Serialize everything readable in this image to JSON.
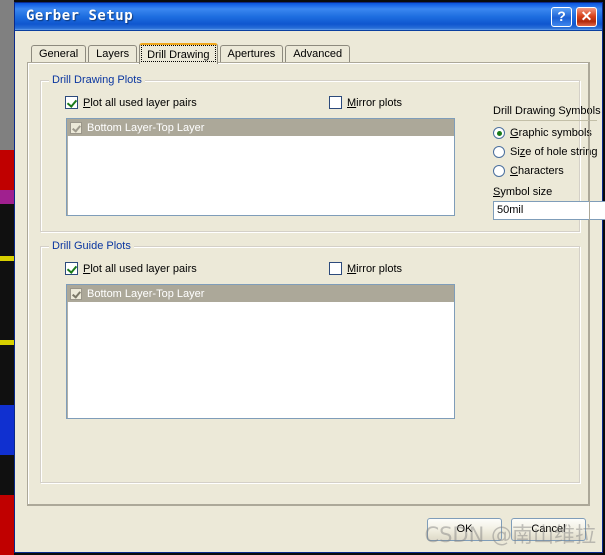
{
  "window": {
    "title": "Gerber Setup",
    "help_button": "?",
    "close_button": "✕"
  },
  "tabs": [
    {
      "label": "General",
      "active": false
    },
    {
      "label": "Layers",
      "active": false
    },
    {
      "label": "Drill Drawing",
      "active": true
    },
    {
      "label": "Apertures",
      "active": false
    },
    {
      "label": "Advanced",
      "active": false
    }
  ],
  "drill_drawing_plots": {
    "group_title": "Drill Drawing Plots",
    "plot_all_label_prefix": "P",
    "plot_all_label_rest": "lot all used layer pairs",
    "plot_all_checked": true,
    "mirror_label_prefix": "M",
    "mirror_label_rest": "irror plots",
    "mirror_checked": false,
    "list_items": [
      {
        "label": "Bottom Layer-Top Layer",
        "checked": true,
        "selected": true
      }
    ]
  },
  "drill_guide_plots": {
    "group_title": "Drill Guide Plots",
    "plot_all_label_prefix": "P",
    "plot_all_label_rest": "lot all used layer pairs",
    "plot_all_checked": true,
    "mirror_label_prefix": "M",
    "mirror_label_rest": "irror plots",
    "mirror_checked": false,
    "list_items": [
      {
        "label": "Bottom Layer-Top Layer",
        "checked": true,
        "selected": true
      }
    ]
  },
  "drill_drawing_symbols": {
    "title": "Drill Drawing Symbols",
    "options": [
      {
        "prefix": "G",
        "rest": "raphic symbols",
        "selected": true
      },
      {
        "prefix_a": "Si",
        "prefix": "z",
        "rest": "e of hole string",
        "selected": false
      },
      {
        "prefix": "C",
        "rest": "haracters",
        "selected": false
      }
    ],
    "symbol_size_label_prefix": "S",
    "symbol_size_label_rest": "ymbol size",
    "symbol_size_value": "50mil"
  },
  "buttons": {
    "ok": "OK",
    "cancel": "Cancel"
  },
  "watermark": "CSDN @南山维拉",
  "colors": {
    "titlebar_blue": "#1a67e8",
    "dialog_face": "#ece9d8",
    "group_label_blue": "#0a36a0",
    "list_selected": "#aca899",
    "active_tab_top": "#f0a71e",
    "check_green": "#1a7a1a"
  }
}
